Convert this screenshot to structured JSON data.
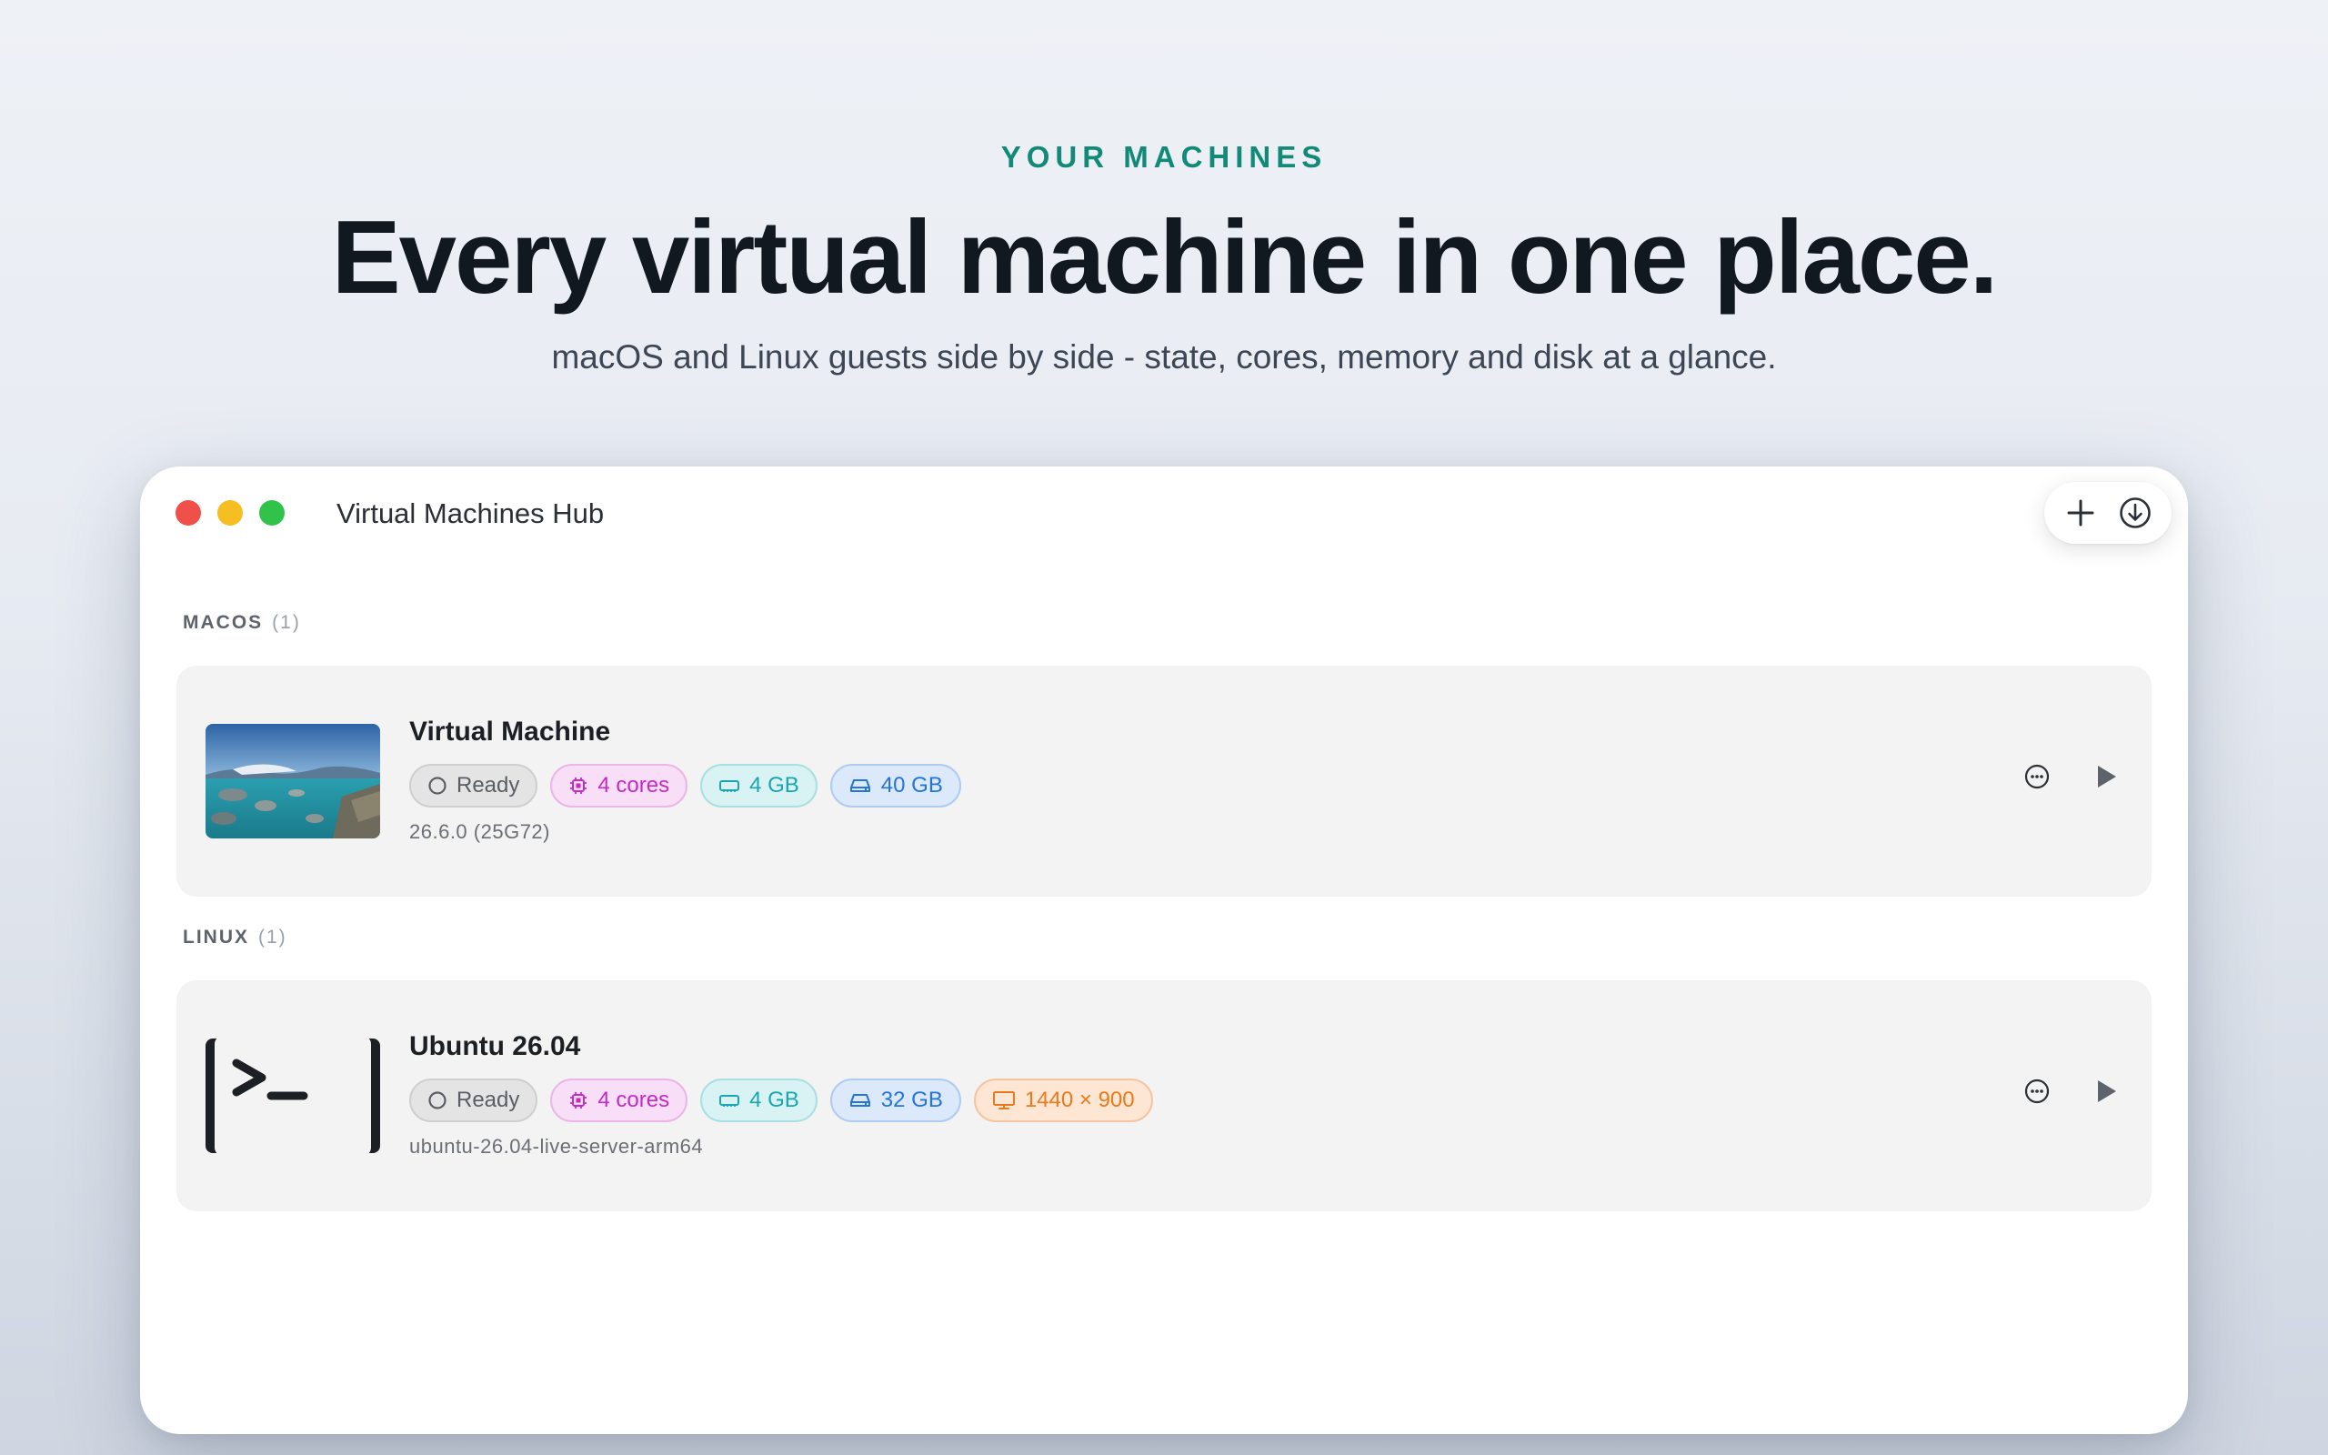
{
  "hero": {
    "eyebrow": "YOUR MACHINES",
    "headline": "Every virtual machine in one place.",
    "subline": "macOS and Linux guests side by side - state, cores, memory and disk at a glance."
  },
  "window": {
    "title": "Virtual Machines Hub",
    "toolbar": {
      "add_icon": "plus-icon",
      "download_icon": "download-circle-icon"
    }
  },
  "sections": [
    {
      "label": "MACOS",
      "count": "(1)",
      "machines": [
        {
          "name": "Virtual Machine",
          "thumbnail": "landscape-image",
          "state": "Ready",
          "cores": "4 cores",
          "memory": "4 GB",
          "disk": "40 GB",
          "subtitle": "26.6.0 (25G72)"
        }
      ]
    },
    {
      "label": "LINUX",
      "count": "(1)",
      "machines": [
        {
          "name": "Ubuntu 26.04",
          "thumbnail": "terminal-icon",
          "state": "Ready",
          "cores": "4 cores",
          "memory": "4 GB",
          "disk": "32 GB",
          "display": "1440 × 900",
          "subtitle": "ubuntu-26.04-live-server-arm64"
        }
      ]
    }
  ],
  "colors": {
    "accent": "#138a78",
    "cores": "#c32bc6",
    "memory": "#1aa6b0",
    "disk": "#2574d8",
    "display": "#ea7a1c"
  }
}
